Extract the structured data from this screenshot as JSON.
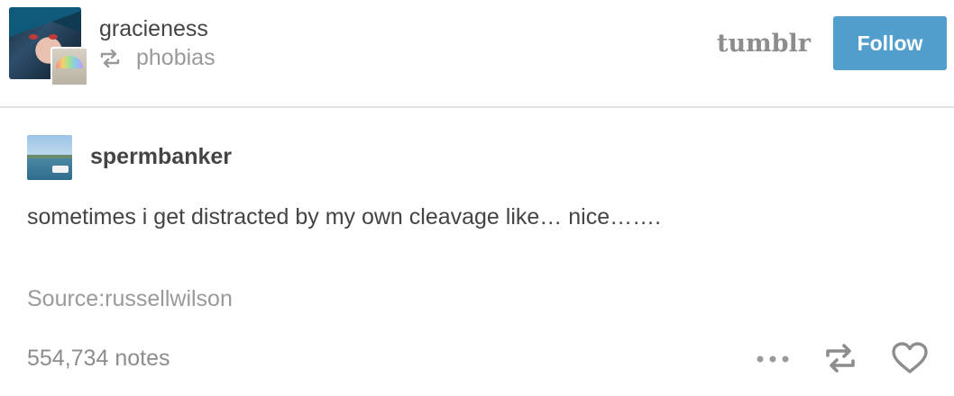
{
  "header": {
    "username": "gracieness",
    "reblogged_from": "phobias",
    "logo_text": "tumblr",
    "follow_label": "Follow"
  },
  "post": {
    "author": "spermbanker",
    "body": "sometimes i get distracted by my own cleavage like… nice…….",
    "source": "Source:russellwilson",
    "notes": "554,734 notes"
  },
  "icons": {
    "reblog_small": "reblog-icon",
    "more": "more-icon",
    "reblog": "reblog-icon",
    "like": "heart-icon"
  },
  "colors": {
    "follow_button": "#529ecc",
    "text": "#444444",
    "muted": "#9a9a9a",
    "divider": "#e2e2e2"
  }
}
